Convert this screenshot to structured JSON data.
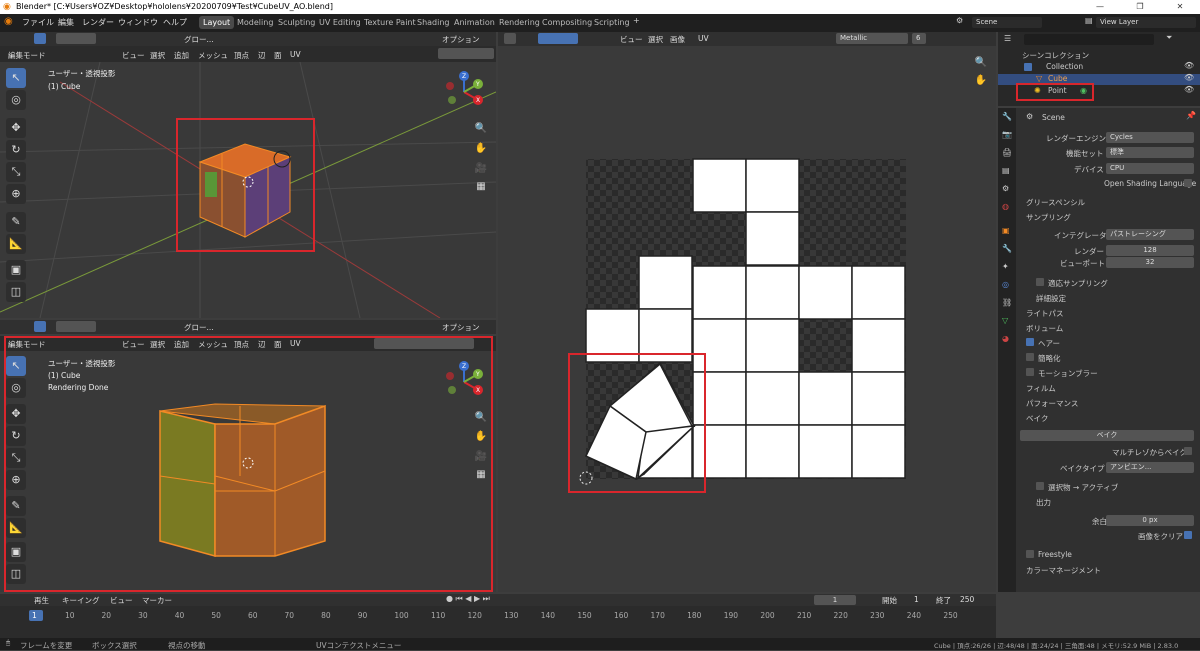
{
  "window": {
    "title": "Blender* [C:¥Users¥OZ¥Desktop¥hololens¥20200709¥Test¥CubeUV_AO.blend]",
    "controls": [
      "—",
      "❐",
      "✕"
    ]
  },
  "menubar": [
    "ファイル",
    "編集",
    "レンダー",
    "ウィンドウ",
    "ヘルプ"
  ],
  "workspaces": [
    "Layout",
    "Modeling",
    "Sculpting",
    "UV Editing",
    "Texture Paint",
    "Shading",
    "Animation",
    "Rendering",
    "Compositing",
    "Scripting"
  ],
  "active_workspace": "Layout",
  "scene_name": "Scene",
  "view_layer": "View Layer",
  "viewport_top": {
    "transform": "グロー...",
    "options": "オプション",
    "mode": "編集モード",
    "menu": [
      "ビュー",
      "選択",
      "追加",
      "メッシュ",
      "頂点",
      "辺",
      "面",
      "UV"
    ],
    "view_name": "ユーザー・透視投影",
    "object": "(1) Cube",
    "axes": [
      "Z",
      "Y",
      "X"
    ]
  },
  "viewport_bottom": {
    "transform": "グロー...",
    "options": "オプション",
    "mode": "編集モード",
    "menu": [
      "ビュー",
      "選択",
      "追加",
      "メッシュ",
      "頂点",
      "辺",
      "面",
      "UV"
    ],
    "view_name": "ユーザー・透視投影",
    "object": "(1) Cube",
    "status": "Rendering Done",
    "axes": [
      "Z",
      "Y",
      "X"
    ]
  },
  "uv_editor": {
    "menu": [
      "ビュー",
      "選択",
      "画像",
      "UV"
    ],
    "image_name": "Metallic",
    "users": "6"
  },
  "outliner": {
    "root": "シーンコレクション",
    "items": [
      {
        "label": "Collection",
        "indent": 1
      },
      {
        "label": "Cube",
        "indent": 2
      },
      {
        "label": "Point",
        "indent": 2
      }
    ]
  },
  "properties": {
    "scene_label": "Scene",
    "render_engine_label": "レンダーエンジン",
    "render_engine": "Cycles",
    "feature_set_label": "機能セット",
    "feature_set": "標準",
    "device_label": "デバイス",
    "device": "CPU",
    "osl": "Open Shading Language",
    "grease_pencil": "グリースペンシル",
    "sampling": "サンプリング",
    "integrator_label": "インテグレータ",
    "integrator": "パストレーシング",
    "render_label": "レンダー",
    "render_samples": "128",
    "viewport_label": "ビューポート",
    "viewport_samples": "32",
    "adaptive": "適応サンプリング",
    "advanced": "詳細設定",
    "light_paths": "ライトパス",
    "volumes": "ボリューム",
    "hair": "ヘアー",
    "simplify": "簡略化",
    "motion_blur": "モーションブラー",
    "film": "フィルム",
    "performance": "パフォーマンス",
    "bake": "ベイク",
    "bake_button": "ベイク",
    "multires": "マルチレゾからベイク",
    "bake_type_label": "ベイクタイプ",
    "bake_type": "アンビエン...",
    "selected_to_active": "選択物 → アクティブ",
    "output": "出力",
    "margin_label": "余白",
    "margin": "0 px",
    "clear_image": "画像をクリア",
    "freestyle": "Freestyle",
    "color_management": "カラーマネージメント"
  },
  "timeline": {
    "menu": [
      "再生",
      "キーイング",
      "ビュー",
      "マーカー"
    ],
    "current_frame": "1",
    "start_label": "開始",
    "start": "1",
    "end_label": "終了",
    "end": "250",
    "ticks": [
      "1",
      "10",
      "20",
      "30",
      "40",
      "50",
      "60",
      "70",
      "80",
      "90",
      "100",
      "110",
      "120",
      "130",
      "140",
      "150",
      "160",
      "170",
      "180",
      "190",
      "200",
      "210",
      "220",
      "230",
      "240",
      "250"
    ]
  },
  "statusbar": {
    "left": [
      "フレームを変更",
      "ボックス選択",
      "視点の移動",
      "UVコンテクストメニュー"
    ],
    "right": "Cube | 頂点:26/26 | 辺:48/48 | 面:24/24 | 三角面:48 | メモリ:52.9 MiB | 2.83.0"
  },
  "colors": {
    "highlight_red": "#d9262c",
    "accent_blue": "#4772b3",
    "edit_orange": "#f28a25"
  }
}
